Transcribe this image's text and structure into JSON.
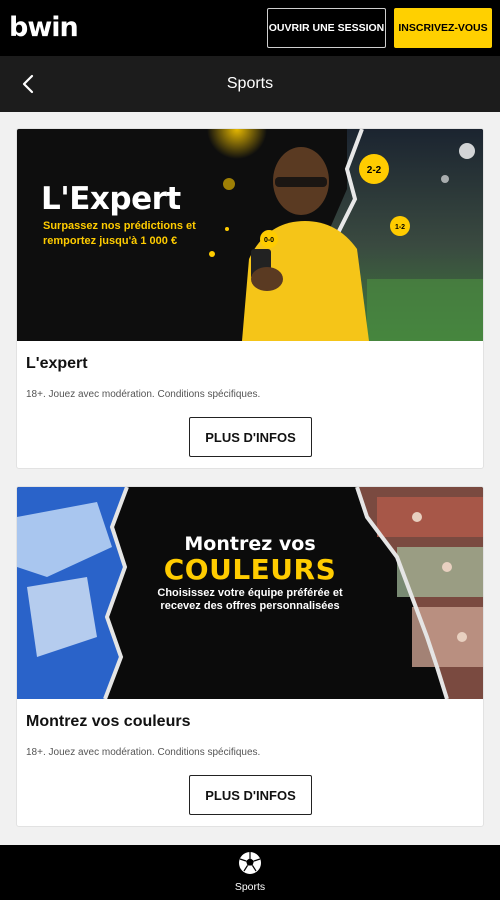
{
  "header": {
    "logo": "bwin",
    "login_label": "OUVRIR UNE SESSION",
    "register_label": "INSCRIVEZ-VOUS"
  },
  "subheader": {
    "title": "Sports",
    "back_icon": "chevron-left-icon"
  },
  "promos": [
    {
      "banner_headline": "L'Expert",
      "banner_tagline": "Surpassez nos prédictions et remportez jusqu'à 1 000 €",
      "banner_badges": [
        "2-2",
        "1-2",
        "0-0"
      ],
      "title": "L'expert",
      "terms": "18+. Jouez avec modération. Conditions spécifiques.",
      "button_label": "PLUS D'INFOS"
    },
    {
      "banner_headline_1": "Montrez vos",
      "banner_headline_2": "COULEURS",
      "banner_tagline": "Choisissez votre équipe préférée et recevez des offres personnalisées",
      "title": "Montrez vos couleurs",
      "terms": "18+. Jouez avec modération. Conditions spécifiques.",
      "button_label": "PLUS D'INFOS"
    }
  ],
  "bottom_nav": {
    "items": [
      {
        "label": "Sports",
        "icon": "soccer-ball-icon"
      }
    ]
  },
  "colors": {
    "brand_yellow": "#ffd000",
    "header_bg": "#000000",
    "subheader_bg": "#1c1c1c"
  }
}
